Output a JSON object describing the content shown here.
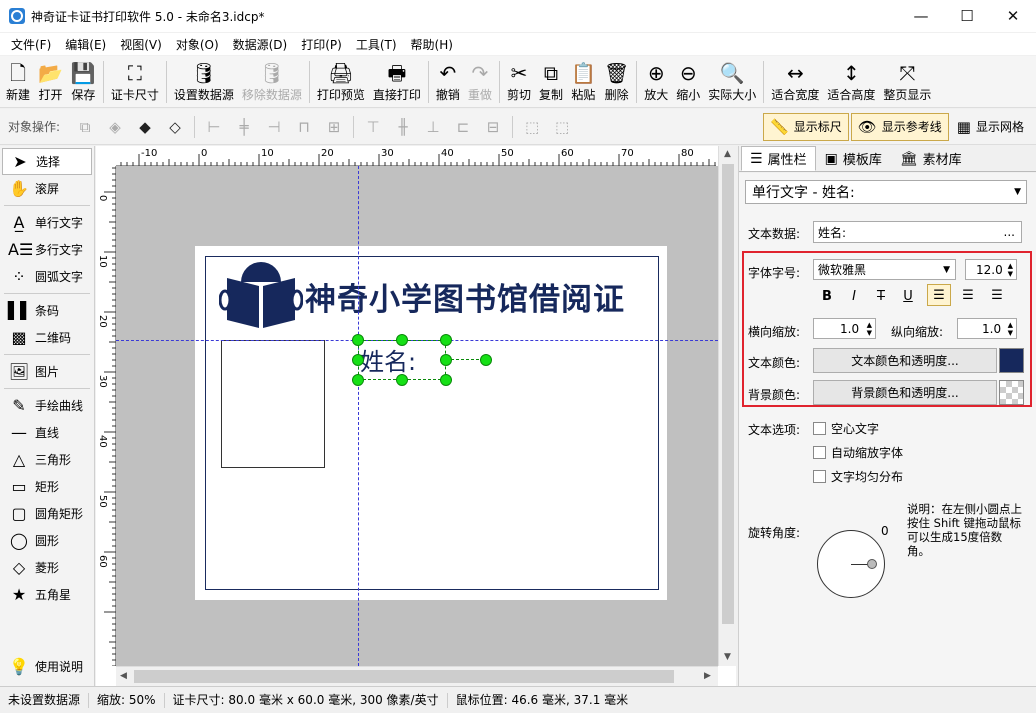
{
  "window": {
    "title": "神奇证卡证书打印软件 5.0 - 未命名3.idcp*",
    "controls": [
      "—",
      "☐",
      "✕"
    ]
  },
  "menu": [
    "文件(F)",
    "编辑(E)",
    "视图(V)",
    "对象(O)",
    "数据源(D)",
    "打印(P)",
    "工具(T)",
    "帮助(H)"
  ],
  "toolbar": [
    {
      "label": "新建",
      "icon": "new-file-icon",
      "glyph": "🗋",
      "enabled": true
    },
    {
      "label": "打开",
      "icon": "open-icon",
      "glyph": "📂",
      "enabled": true
    },
    {
      "label": "保存",
      "icon": "save-icon",
      "glyph": "💾",
      "enabled": true
    },
    {
      "label": "证卡尺寸",
      "icon": "card-size-icon",
      "glyph": "⛶",
      "enabled": true
    },
    {
      "label": "设置数据源",
      "icon": "datasource-icon",
      "glyph": "🛢",
      "enabled": true
    },
    {
      "label": "移除数据源",
      "icon": "remove-datasource-icon",
      "glyph": "🛢",
      "enabled": false
    },
    {
      "label": "打印预览",
      "icon": "print-preview-icon",
      "glyph": "🖨",
      "enabled": true
    },
    {
      "label": "直接打印",
      "icon": "print-icon",
      "glyph": "🖶",
      "enabled": true
    },
    {
      "label": "撤销",
      "icon": "undo-icon",
      "glyph": "↶",
      "enabled": true
    },
    {
      "label": "重做",
      "icon": "redo-icon",
      "glyph": "↷",
      "enabled": false
    },
    {
      "label": "剪切",
      "icon": "cut-icon",
      "glyph": "✂",
      "enabled": true
    },
    {
      "label": "复制",
      "icon": "copy-icon",
      "glyph": "⧉",
      "enabled": true
    },
    {
      "label": "粘贴",
      "icon": "paste-icon",
      "glyph": "📋",
      "enabled": true
    },
    {
      "label": "删除",
      "icon": "delete-icon",
      "glyph": "🗑",
      "enabled": true
    },
    {
      "label": "放大",
      "icon": "zoom-in-icon",
      "glyph": "⊕",
      "enabled": true
    },
    {
      "label": "缩小",
      "icon": "zoom-out-icon",
      "glyph": "⊖",
      "enabled": true
    },
    {
      "label": "实际大小",
      "icon": "actual-size-icon",
      "glyph": "🔍",
      "enabled": true
    },
    {
      "label": "适合宽度",
      "icon": "fit-width-icon",
      "glyph": "↔",
      "enabled": true
    },
    {
      "label": "适合高度",
      "icon": "fit-height-icon",
      "glyph": "↕",
      "enabled": true
    },
    {
      "label": "整页显示",
      "icon": "fit-page-icon",
      "glyph": "⤧",
      "enabled": true
    }
  ],
  "objbar": {
    "label": "对象操作:",
    "toggles": [
      {
        "label": "显示标尺",
        "icon": "ruler-icon",
        "glyph": "📏",
        "active": true
      },
      {
        "label": "显示参考线",
        "icon": "guideline-icon",
        "glyph": "👁",
        "active": true
      },
      {
        "label": "显示网格",
        "icon": "grid-icon",
        "glyph": "▦",
        "active": false
      }
    ]
  },
  "tools": [
    {
      "label": "选择",
      "icon": "select-arrow-icon",
      "glyph": "➤",
      "selected": true
    },
    {
      "label": "滚屏",
      "icon": "hand-icon",
      "glyph": "✋"
    },
    {
      "sep": true
    },
    {
      "label": "单行文字",
      "icon": "single-text-icon",
      "glyph": "A̲"
    },
    {
      "label": "多行文字",
      "icon": "multiline-text-icon",
      "glyph": "A☰"
    },
    {
      "label": "圆弧文字",
      "icon": "arc-text-icon",
      "glyph": "⁘"
    },
    {
      "sep": true
    },
    {
      "label": "条码",
      "icon": "barcode-icon",
      "glyph": "▌▌"
    },
    {
      "label": "二维码",
      "icon": "qrcode-icon",
      "glyph": "▩"
    },
    {
      "sep": true
    },
    {
      "label": "图片",
      "icon": "image-icon",
      "glyph": "🖼"
    },
    {
      "sep": true
    },
    {
      "label": "手绘曲线",
      "icon": "pen-icon",
      "glyph": "✎"
    },
    {
      "label": "直线",
      "icon": "line-icon",
      "glyph": "—"
    },
    {
      "label": "三角形",
      "icon": "triangle-icon",
      "glyph": "△"
    },
    {
      "label": "矩形",
      "icon": "rectangle-icon",
      "glyph": "▭"
    },
    {
      "label": "圆角矩形",
      "icon": "rounded-rect-icon",
      "glyph": "▢"
    },
    {
      "label": "圆形",
      "icon": "ellipse-icon",
      "glyph": "◯"
    },
    {
      "label": "菱形",
      "icon": "diamond-icon",
      "glyph": "◇"
    },
    {
      "label": "五角星",
      "icon": "star-icon",
      "glyph": "★"
    }
  ],
  "help": {
    "label": "使用说明",
    "icon": "lightbulb-icon",
    "glyph": "💡"
  },
  "ruler": {
    "h_ticks": [
      "-10",
      "0",
      "10",
      "20",
      "30",
      "40",
      "50",
      "60",
      "70",
      "80"
    ],
    "v_ticks": [
      "0",
      "10",
      "20",
      "30",
      "40",
      "50",
      "60"
    ]
  },
  "card": {
    "title": "神奇小学图书馆借阅证",
    "name_text": "姓名:",
    "title_color": "#16285c"
  },
  "panel": {
    "tabs": [
      {
        "label": "属性栏",
        "icon": "properties-icon",
        "glyph": "☰",
        "active": true
      },
      {
        "label": "模板库",
        "icon": "template-icon",
        "glyph": "▣",
        "active": false
      },
      {
        "label": "素材库",
        "icon": "library-icon",
        "glyph": "🏛",
        "active": false
      }
    ],
    "object_select": "单行文字 - 姓名:",
    "text_data_label": "文本数据:",
    "text_data_value": "姓名:",
    "text_data_btn": "...",
    "font_label": "字体字号:",
    "font_name": "微软雅黑",
    "font_size": "12.0",
    "format_buttons": [
      "B",
      "I",
      "T",
      "U"
    ],
    "align_buttons": [
      "left-align-icon",
      "center-align-icon",
      "right-align-icon"
    ],
    "hscale_label": "横向缩放:",
    "hscale_value": "1.0",
    "vscale_label": "纵向缩放:",
    "vscale_value": "1.0",
    "textcolor_label": "文本颜色:",
    "textcolor_btn": "文本颜色和透明度...",
    "text_color": "#16285c",
    "bgcolor_label": "背景颜色:",
    "bgcolor_btn": "背景颜色和透明度...",
    "options_label": "文本选项:",
    "options": [
      "空心文字",
      "自动缩放字体",
      "文字均匀分布"
    ],
    "rotation_label": "旋转角度:",
    "rotation_value": "0",
    "rotation_note": "说明：在左侧小圆点上按住 Shift 键拖动鼠标可以生成15度倍数角。"
  },
  "status": [
    "未设置数据源",
    "缩放: 50%",
    "证卡尺寸: 80.0 毫米 x 60.0 毫米, 300 像素/英寸",
    "鼠标位置: 46.6 毫米, 37.1 毫米"
  ]
}
